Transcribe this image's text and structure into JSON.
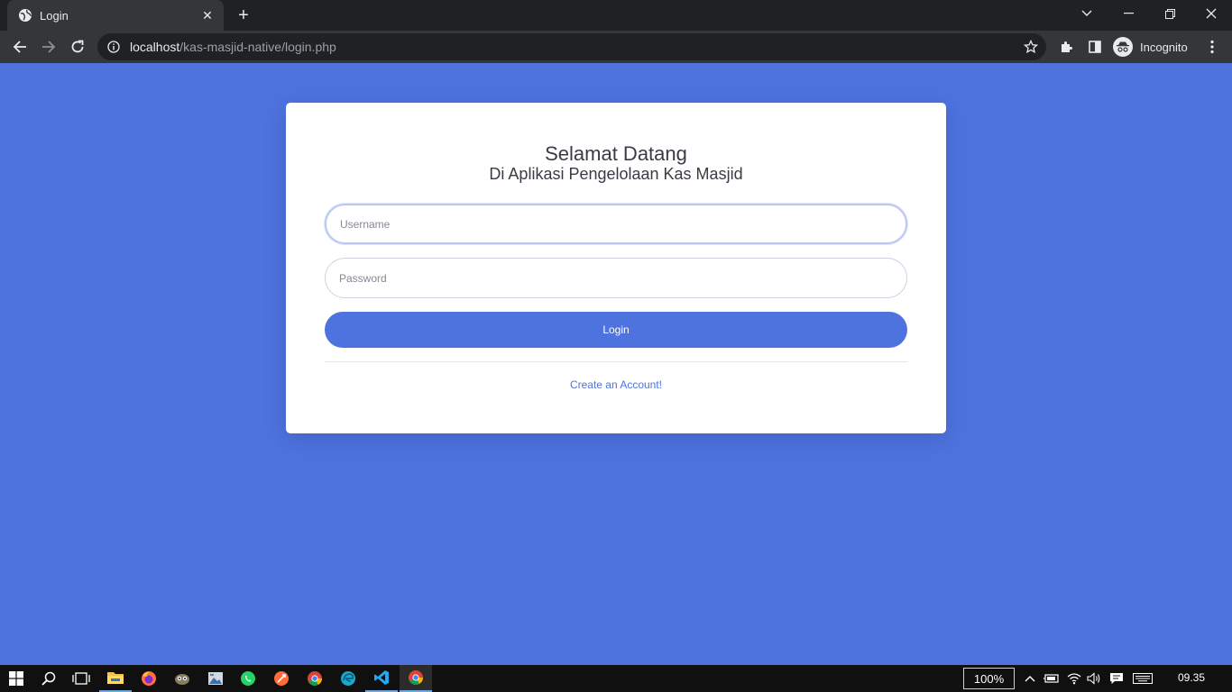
{
  "browser": {
    "tab_title": "Login",
    "tab_close": "✕",
    "new_tab": "+",
    "url_host": "localhost",
    "url_path": "/kas-masjid-native/login.php",
    "profile_label": "Incognito"
  },
  "card": {
    "title": "Selamat Datang",
    "subtitle": "Di Aplikasi Pengelolaan Kas Masjid",
    "username_placeholder": "Username",
    "password_placeholder": "Password",
    "login_label": "Login",
    "create_account_label": "Create an Account!"
  },
  "taskbar": {
    "zoom": "100%",
    "time": "09.35"
  },
  "colors": {
    "page_bg": "#4e73df",
    "primary": "#4e73df",
    "card_bg": "#ffffff",
    "chrome_dark": "#202124",
    "chrome_toolbar": "#35363a",
    "taskbar": "#101010"
  },
  "icons": {
    "tab_favicon": "globe-icon",
    "back": "arrow-left-icon",
    "forward": "arrow-right-icon",
    "reload": "reload-icon",
    "site_info": "info-icon",
    "bookmark": "star-icon",
    "extensions": "puzzle-icon",
    "side_panel": "side-panel-icon",
    "incognito": "incognito-icon",
    "menu": "kebab-menu-icon"
  }
}
